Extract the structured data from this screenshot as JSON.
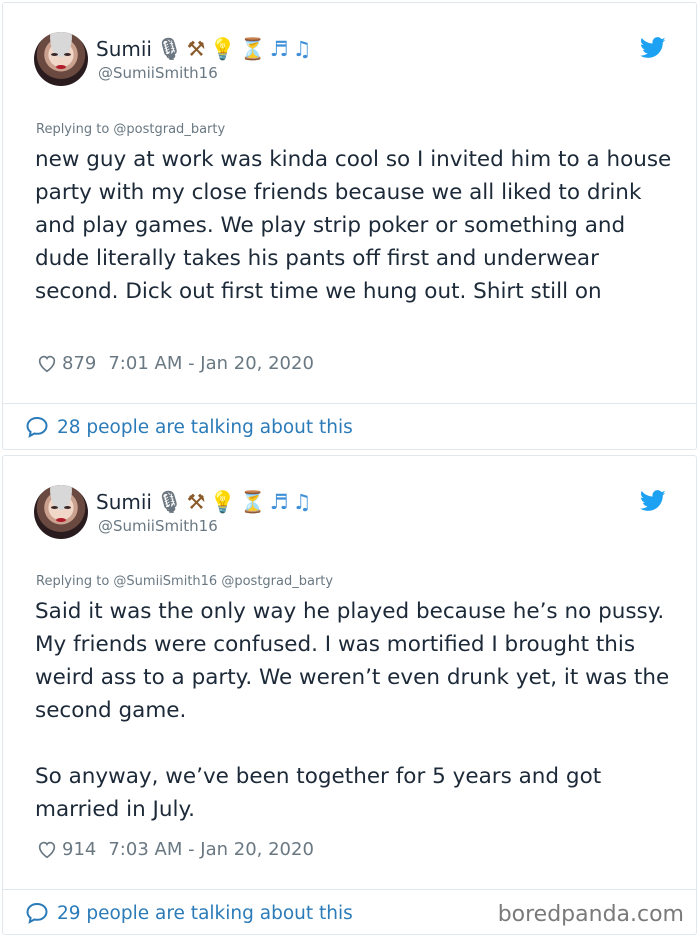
{
  "colors": {
    "link": "#2b7bb9",
    "muted": "#697882",
    "text": "#1c2938",
    "twitter_blue": "#1da1f2"
  },
  "tweets": [
    {
      "author": {
        "name": "Sumii",
        "handle": "@SumiiSmith16",
        "name_emojis": [
          "microphone",
          "hammer",
          "bulb",
          "hourglass",
          "music-notes",
          "music-note"
        ]
      },
      "replying": "Replying to @postgrad_barty",
      "text": "new guy at work was kinda cool so I invited him to a house party with my close friends because we all liked to drink and play games. We play strip poker or something and dude literally takes his pants off first and underwear second. Dick out first time we hung out. Shirt still on",
      "likes": "879",
      "timestamp": "7:01 AM - Jan 20, 2020",
      "talking": "28 people are talking about this"
    },
    {
      "author": {
        "name": "Sumii",
        "handle": "@SumiiSmith16",
        "name_emojis": [
          "microphone",
          "hammer",
          "bulb",
          "hourglass",
          "music-notes",
          "music-note"
        ]
      },
      "replying": "Replying to @SumiiSmith16 @postgrad_barty",
      "text": "Said it was the only way he played because he’s no pussy. My friends were confused. I was mortified I brought this weird ass to a party. We weren’t even drunk yet, it was the second game.\n\nSo anyway, we’ve been together for 5 years and got married in July.",
      "likes": "914",
      "timestamp": "7:03 AM - Jan 20, 2020",
      "talking": "29 people are talking about this"
    }
  ],
  "watermark": "boredpanda.com"
}
